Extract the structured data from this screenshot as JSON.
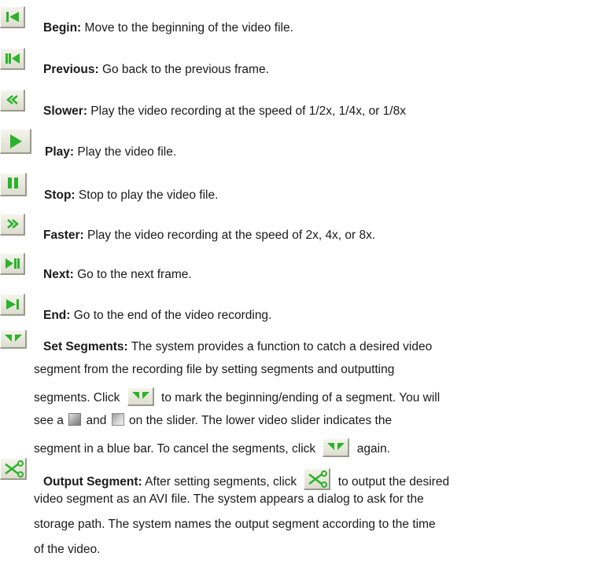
{
  "items": [
    {
      "icon": "begin-icon",
      "title": "Begin:",
      "desc": "Move to the beginning of the video file."
    },
    {
      "icon": "previous-icon",
      "title": "Previous:",
      "desc": "Go back to the previous frame."
    },
    {
      "icon": "slower-icon",
      "title": "Slower:",
      "desc": "Play the video recording at the speed of 1/2x, 1/4x, or 1/8x"
    },
    {
      "icon": "play-icon",
      "title": "Play:",
      "desc": "Play the video file."
    },
    {
      "icon": "stop-icon",
      "title": "Stop:",
      "desc": "Stop to play the video file."
    },
    {
      "icon": "faster-icon",
      "title": "Faster:",
      "desc": "Play the video recording at the speed of 2x, 4x, or 8x."
    },
    {
      "icon": "next-icon",
      "title": "Next:",
      "desc": "Go to the next frame."
    },
    {
      "icon": "end-icon",
      "title": "End:",
      "desc": "Go to the end of the video recording."
    }
  ],
  "set_segments": {
    "icon": "set-segments-icon",
    "title": "Set Segments:",
    "line1": "The system provides a function to catch a desired video",
    "line2": "segment from the recording file by setting segments and outputting",
    "line3_a": "segments. Click",
    "line3_b": "to mark the beginning/ending of a segment. You will",
    "line4_a": "see a",
    "line4_b": "and",
    "line4_c": "on the slider. The lower video slider indicates the",
    "line5_a": "segment in a blue bar. To cancel the segments, click",
    "line5_b": "again.",
    "marker_begin_icon": "segment-begin-marker-icon",
    "marker_end_icon": "segment-end-marker-icon"
  },
  "output_segment": {
    "icon": "output-segment-icon",
    "title": "Output Segment:",
    "line1_a": "After setting segments, click",
    "line1_b": "to output the desired",
    "line2": "video segment as an AVI file. The system appears a dialog to ask for the",
    "line3": "storage path. The system names the output segment according to the time",
    "line4": "of the video."
  },
  "colors": {
    "icon_green": "#2bb32b",
    "button_face": "#e8e8dc"
  }
}
